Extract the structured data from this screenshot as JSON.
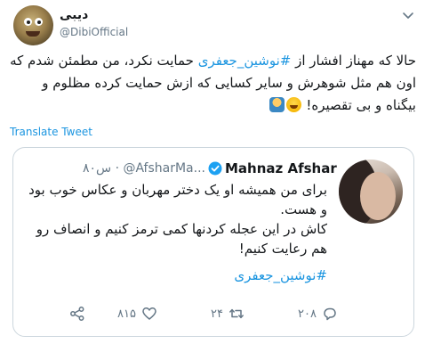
{
  "author": {
    "display_name": "دیبی",
    "handle": "@DibiOfficial"
  },
  "tweet": {
    "text_part1": "حالا که مهناز افشار از ",
    "hashtag": "#نوشین_جعفری",
    "text_part2": " حمایت نکرد، من مطمئن شدم که اون هم مثل شوهرش و سایر کسایی که ازش حمایت کرده مظلوم و بیگناه و بی تقصیره!",
    "emojis": [
      "laughing-emoji",
      "shrug-emoji"
    ]
  },
  "translate_label": "Translate Tweet",
  "quote": {
    "display_name": "Mahnaz Afshar",
    "verified": true,
    "handle": "@AfsharMa...",
    "time": "۸۰س",
    "dots": "·",
    "text": "برای من همیشه او یک دختر مهربان و عکاس خوب بود و هست.\nکاش در این عجله کردنها کمی ترمز کنیم و انصاف رو هم رعایت کنیم!",
    "text_line1": "برای من همیشه او یک دختر مهربان و عکاس خوب بود و هست.",
    "text_line2": "کاش در این عجله کردنها کمی ترمز کنیم و انصاف رو هم رعایت کنیم!",
    "hashtag": "#نوشین_جعفری"
  },
  "actions": {
    "reply_count": "۲۰۸",
    "retweet_count": "۲۴",
    "like_count": "۸۱۵"
  },
  "colors": {
    "link": "#1b95e0",
    "secondary": "#657786",
    "border": "#ccd6dd",
    "text": "#14171a"
  },
  "icons": [
    "caret-down-icon",
    "verified-badge-icon",
    "reply-icon",
    "retweet-icon",
    "like-icon",
    "share-icon"
  ]
}
